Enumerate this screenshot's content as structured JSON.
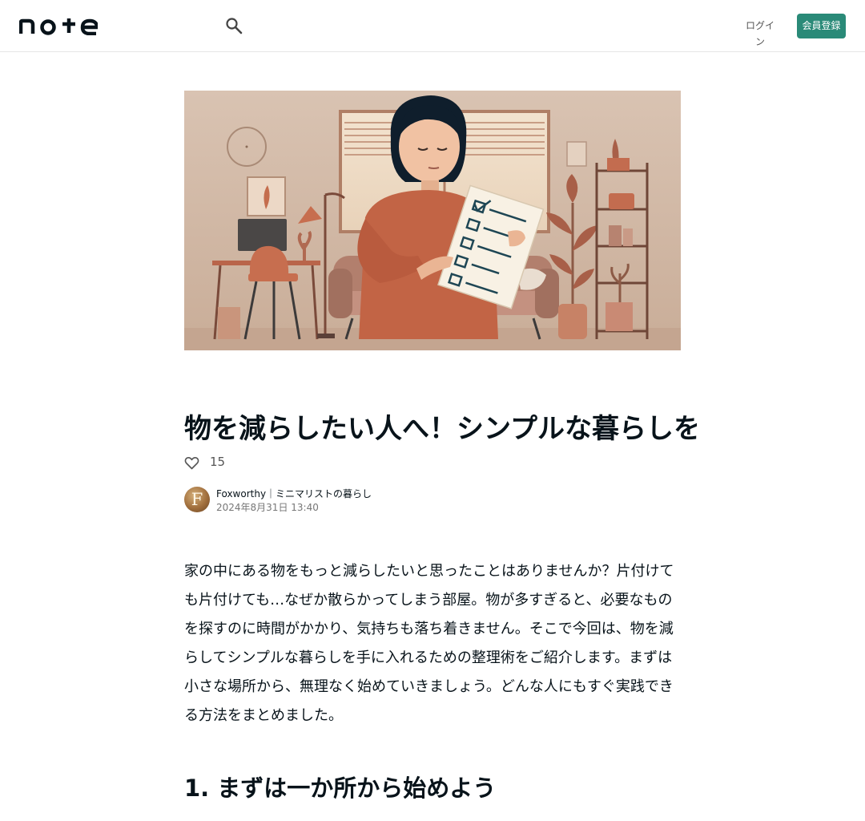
{
  "header": {
    "logo_text": "note",
    "login_label": "ログイン",
    "signup_label": "会員登録",
    "accent_color": "#2a8a78"
  },
  "article": {
    "title": "物を減らしたい人へ！シンプルな暮らしを手に入れるための整理術",
    "like_count": "15",
    "author_name": "Foxworthy｜ミニマリストの暮らし",
    "avatar_letter": "F",
    "date": "2024年8月31日 13:40",
    "paragraph": "家の中にある物をもっと減らしたいと思ったことはありませんか？片付けても片付けても…なぜか散らかってしまう部屋。物が多すぎると、必要なものを探すのに時間がかかり、気持ちも落ち着きません。そこで今回は、物を減らしてシンプルな暮らしを手に入れるための整理術をご紹介します。まずは小さな場所から、無理なく始めていきましょう。どんな人にもすぐ実践できる方法をまとめました。",
    "section_heading": "1. まずは一か所から始めよう"
  },
  "icons": {
    "search": "search-icon",
    "like": "heart-icon"
  }
}
